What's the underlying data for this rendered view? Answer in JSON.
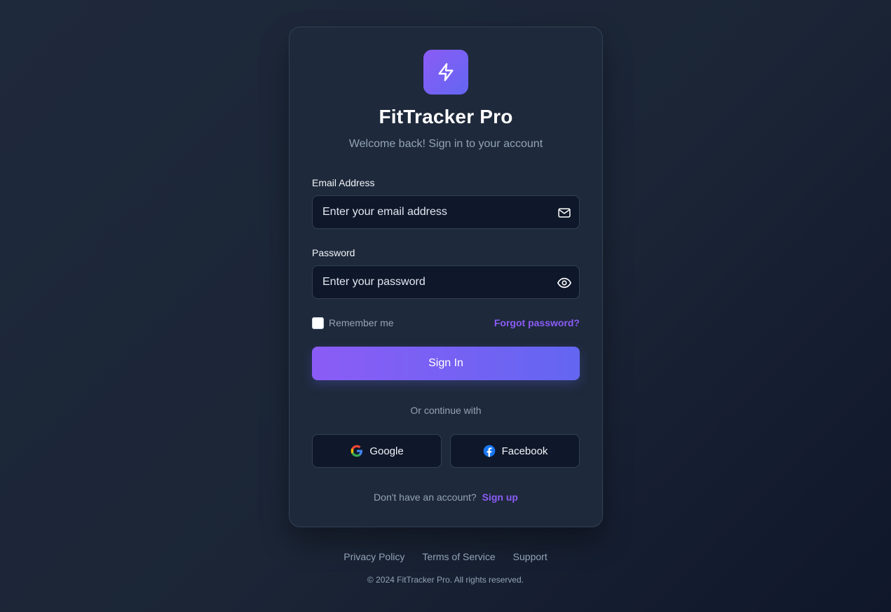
{
  "app": {
    "title": "FitTracker Pro",
    "subtitle": "Welcome back! Sign in to your account",
    "logo_icon": "lightning-bolt-icon"
  },
  "form": {
    "email": {
      "label": "Email Address",
      "placeholder": "Enter your email address",
      "value": "",
      "icon": "mail-icon"
    },
    "password": {
      "label": "Password",
      "placeholder": "Enter your password",
      "value": "",
      "icon": "eye-icon"
    },
    "remember_label": "Remember me",
    "remember_checked": false,
    "forgot_label": "Forgot password?",
    "submit_label": "Sign In"
  },
  "social": {
    "divider_text": "Or continue with",
    "google_label": "Google",
    "facebook_label": "Facebook"
  },
  "signup": {
    "prompt": "Don't have an account?",
    "link_label": "Sign up"
  },
  "footer": {
    "links": [
      "Privacy Policy",
      "Terms of Service",
      "Support"
    ],
    "copyright": "© 2024 FitTracker Pro. All rights reserved."
  },
  "colors": {
    "accent": "#8b5cf6",
    "accent_secondary": "#6366f1",
    "card_bg": "#1e293b",
    "input_bg": "#0f172a",
    "muted_text": "#94a3b8"
  }
}
